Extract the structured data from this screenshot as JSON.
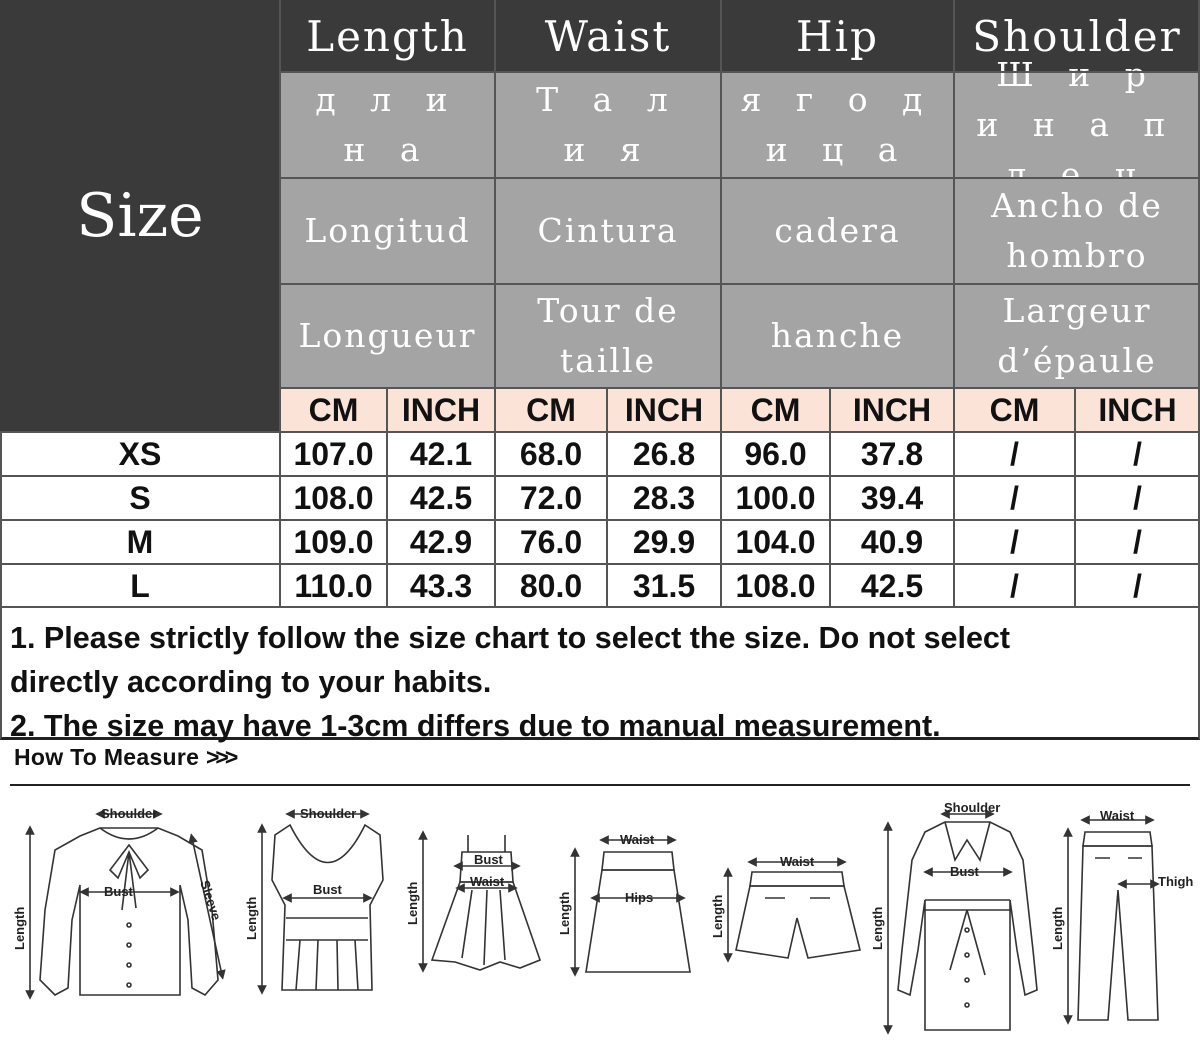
{
  "table": {
    "size_header": "Size",
    "columns": [
      {
        "en": "Length",
        "ru": "д л и н а",
        "es": "Longitud",
        "fr": "Longueur"
      },
      {
        "en": "Waist",
        "ru": "Т а л и я",
        "es": "Cintura",
        "fr": "Tour de taille"
      },
      {
        "en": "Hip",
        "ru": "я г о д и ц а",
        "es": "cadera",
        "fr": "hanche"
      },
      {
        "en": "Shoulder",
        "ru": "Ш и р и н а п л е ч",
        "es": "Ancho de hombro",
        "fr": "Largeur d’épaule"
      }
    ],
    "units": [
      "CM",
      "INCH",
      "CM",
      "INCH",
      "CM",
      "INCH",
      "CM",
      "INCH"
    ],
    "rows": [
      {
        "size": "XS",
        "values": [
          "107.0",
          "42.1",
          "68.0",
          "26.8",
          "96.0",
          "37.8",
          "/",
          "/"
        ]
      },
      {
        "size": "S",
        "values": [
          "108.0",
          "42.5",
          "72.0",
          "28.3",
          "100.0",
          "39.4",
          "/",
          "/"
        ]
      },
      {
        "size": "M",
        "values": [
          "109.0",
          "42.9",
          "76.0",
          "29.9",
          "104.0",
          "40.9",
          "/",
          "/"
        ]
      },
      {
        "size": "L",
        "values": [
          "110.0",
          "43.3",
          "80.0",
          "31.5",
          "108.0",
          "42.5",
          "/",
          "/"
        ]
      }
    ]
  },
  "notes": [
    "1. Please strictly follow the size chart to select the size. Do not select",
    "directly according to your habits.",
    "2. The size may have 1-3cm differs due to manual measurement."
  ],
  "how_to_measure": {
    "title": "How To Measure",
    "arrows": ">>>",
    "labels": {
      "shoulder": "Shoulder",
      "bust": "Bust",
      "sleeve": "Sleeve",
      "length": "Length",
      "waist": "Waist",
      "hips": "Hips",
      "thigh": "Thigh"
    }
  }
}
